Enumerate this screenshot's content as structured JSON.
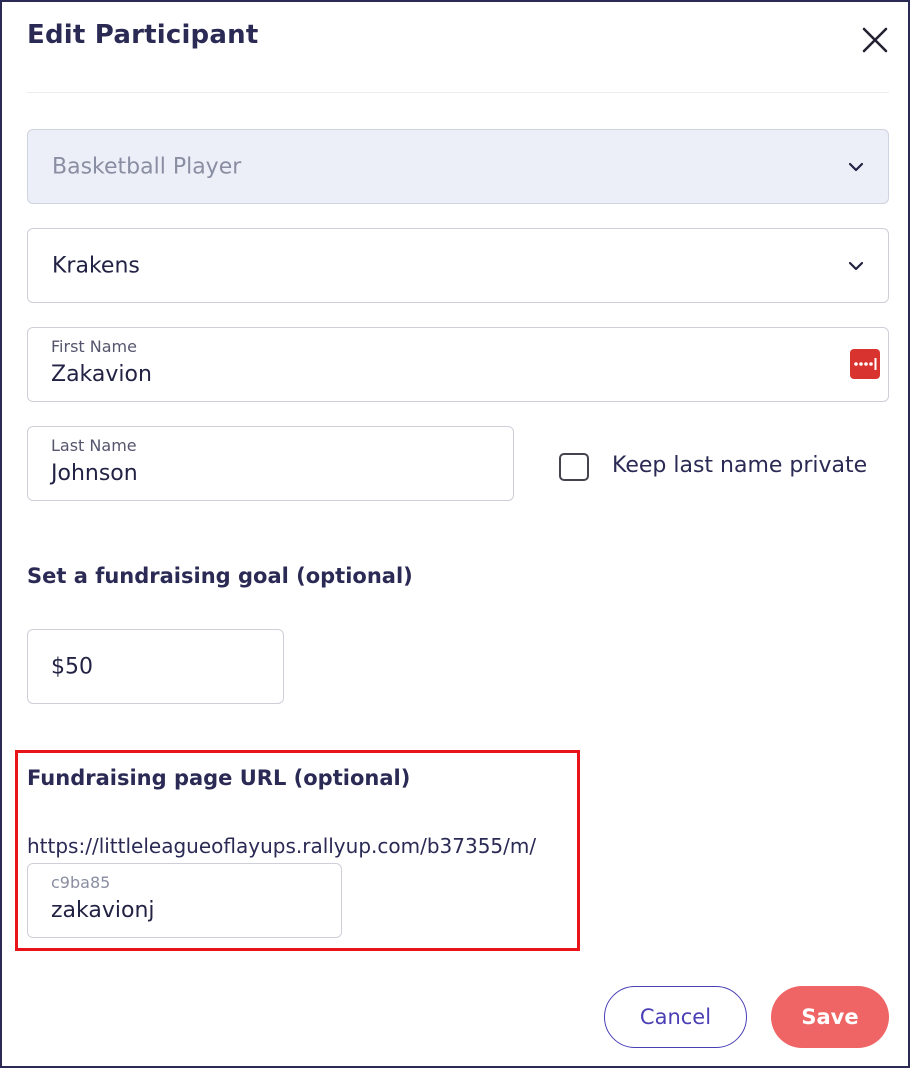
{
  "dialog": {
    "title": "Edit Participant"
  },
  "form": {
    "role_select": {
      "value": "Basketball Player",
      "disabled": true
    },
    "team_select": {
      "value": "Krakens"
    },
    "first_name": {
      "label": "First Name",
      "value": "Zakavion"
    },
    "last_name": {
      "label": "Last Name",
      "value": "Johnson"
    },
    "keep_private": {
      "label": "Keep last name private",
      "checked": false
    },
    "goal_section": {
      "heading": "Set a fundraising goal (optional)",
      "value": "$50"
    },
    "url_section": {
      "heading": "Fundraising page URL (optional)",
      "prefix": "https://littleleagueoflayups.rallyup.com/b37355/m/",
      "placeholder": "c9ba85",
      "value": "zakavionj"
    }
  },
  "footer": {
    "cancel_label": "Cancel",
    "save_label": "Save"
  },
  "icons": {
    "close": "close-icon",
    "chevron": "chevron-down-icon",
    "password_manager": "password-manager-icon"
  },
  "colors": {
    "accent": "#4a3fb5",
    "save_button": "#ef6565",
    "highlight": "#e8141a",
    "password_icon": "#d8332e"
  }
}
